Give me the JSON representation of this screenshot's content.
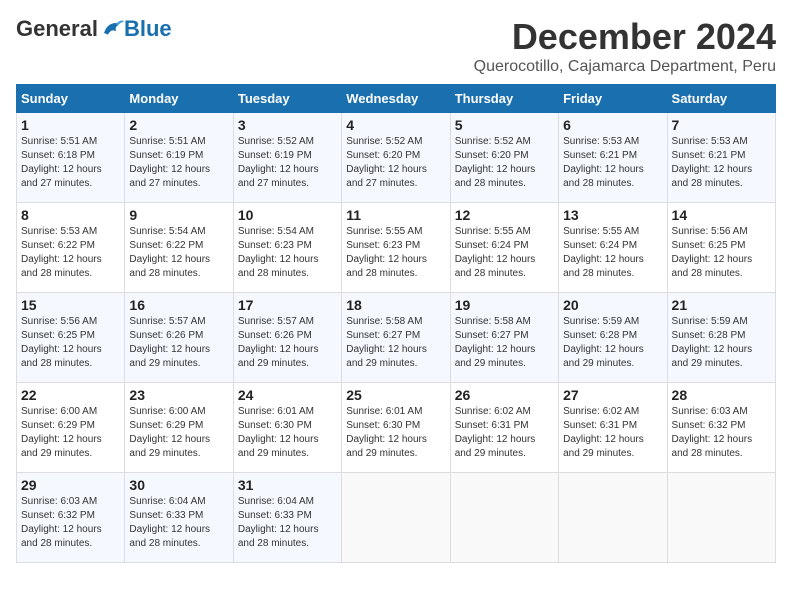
{
  "logo": {
    "general": "General",
    "blue": "Blue"
  },
  "title": "December 2024",
  "location": "Querocotillo, Cajamarca Department, Peru",
  "days_of_week": [
    "Sunday",
    "Monday",
    "Tuesday",
    "Wednesday",
    "Thursday",
    "Friday",
    "Saturday"
  ],
  "weeks": [
    [
      {
        "day": "1",
        "sunrise": "5:51 AM",
        "sunset": "6:18 PM",
        "daylight": "12 hours and 27 minutes."
      },
      {
        "day": "2",
        "sunrise": "5:51 AM",
        "sunset": "6:19 PM",
        "daylight": "12 hours and 27 minutes."
      },
      {
        "day": "3",
        "sunrise": "5:52 AM",
        "sunset": "6:19 PM",
        "daylight": "12 hours and 27 minutes."
      },
      {
        "day": "4",
        "sunrise": "5:52 AM",
        "sunset": "6:20 PM",
        "daylight": "12 hours and 27 minutes."
      },
      {
        "day": "5",
        "sunrise": "5:52 AM",
        "sunset": "6:20 PM",
        "daylight": "12 hours and 28 minutes."
      },
      {
        "day": "6",
        "sunrise": "5:53 AM",
        "sunset": "6:21 PM",
        "daylight": "12 hours and 28 minutes."
      },
      {
        "day": "7",
        "sunrise": "5:53 AM",
        "sunset": "6:21 PM",
        "daylight": "12 hours and 28 minutes."
      }
    ],
    [
      {
        "day": "8",
        "sunrise": "5:53 AM",
        "sunset": "6:22 PM",
        "daylight": "12 hours and 28 minutes."
      },
      {
        "day": "9",
        "sunrise": "5:54 AM",
        "sunset": "6:22 PM",
        "daylight": "12 hours and 28 minutes."
      },
      {
        "day": "10",
        "sunrise": "5:54 AM",
        "sunset": "6:23 PM",
        "daylight": "12 hours and 28 minutes."
      },
      {
        "day": "11",
        "sunrise": "5:55 AM",
        "sunset": "6:23 PM",
        "daylight": "12 hours and 28 minutes."
      },
      {
        "day": "12",
        "sunrise": "5:55 AM",
        "sunset": "6:24 PM",
        "daylight": "12 hours and 28 minutes."
      },
      {
        "day": "13",
        "sunrise": "5:55 AM",
        "sunset": "6:24 PM",
        "daylight": "12 hours and 28 minutes."
      },
      {
        "day": "14",
        "sunrise": "5:56 AM",
        "sunset": "6:25 PM",
        "daylight": "12 hours and 28 minutes."
      }
    ],
    [
      {
        "day": "15",
        "sunrise": "5:56 AM",
        "sunset": "6:25 PM",
        "daylight": "12 hours and 28 minutes."
      },
      {
        "day": "16",
        "sunrise": "5:57 AM",
        "sunset": "6:26 PM",
        "daylight": "12 hours and 29 minutes."
      },
      {
        "day": "17",
        "sunrise": "5:57 AM",
        "sunset": "6:26 PM",
        "daylight": "12 hours and 29 minutes."
      },
      {
        "day": "18",
        "sunrise": "5:58 AM",
        "sunset": "6:27 PM",
        "daylight": "12 hours and 29 minutes."
      },
      {
        "day": "19",
        "sunrise": "5:58 AM",
        "sunset": "6:27 PM",
        "daylight": "12 hours and 29 minutes."
      },
      {
        "day": "20",
        "sunrise": "5:59 AM",
        "sunset": "6:28 PM",
        "daylight": "12 hours and 29 minutes."
      },
      {
        "day": "21",
        "sunrise": "5:59 AM",
        "sunset": "6:28 PM",
        "daylight": "12 hours and 29 minutes."
      }
    ],
    [
      {
        "day": "22",
        "sunrise": "6:00 AM",
        "sunset": "6:29 PM",
        "daylight": "12 hours and 29 minutes."
      },
      {
        "day": "23",
        "sunrise": "6:00 AM",
        "sunset": "6:29 PM",
        "daylight": "12 hours and 29 minutes."
      },
      {
        "day": "24",
        "sunrise": "6:01 AM",
        "sunset": "6:30 PM",
        "daylight": "12 hours and 29 minutes."
      },
      {
        "day": "25",
        "sunrise": "6:01 AM",
        "sunset": "6:30 PM",
        "daylight": "12 hours and 29 minutes."
      },
      {
        "day": "26",
        "sunrise": "6:02 AM",
        "sunset": "6:31 PM",
        "daylight": "12 hours and 29 minutes."
      },
      {
        "day": "27",
        "sunrise": "6:02 AM",
        "sunset": "6:31 PM",
        "daylight": "12 hours and 29 minutes."
      },
      {
        "day": "28",
        "sunrise": "6:03 AM",
        "sunset": "6:32 PM",
        "daylight": "12 hours and 28 minutes."
      }
    ],
    [
      {
        "day": "29",
        "sunrise": "6:03 AM",
        "sunset": "6:32 PM",
        "daylight": "12 hours and 28 minutes."
      },
      {
        "day": "30",
        "sunrise": "6:04 AM",
        "sunset": "6:33 PM",
        "daylight": "12 hours and 28 minutes."
      },
      {
        "day": "31",
        "sunrise": "6:04 AM",
        "sunset": "6:33 PM",
        "daylight": "12 hours and 28 minutes."
      },
      null,
      null,
      null,
      null
    ]
  ]
}
